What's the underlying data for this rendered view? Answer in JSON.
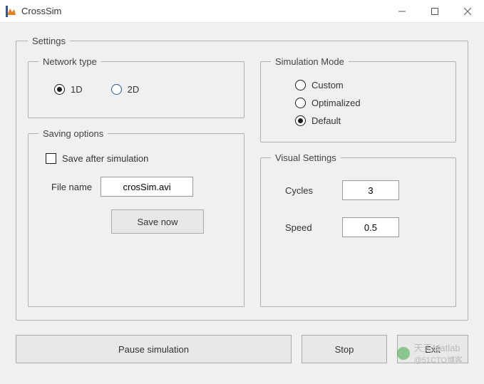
{
  "window": {
    "title": "CrossSim"
  },
  "settings": {
    "legend": "Settings",
    "networkType": {
      "legend": "Network type",
      "options": {
        "one": "1D",
        "two": "2D"
      },
      "selected": "1D"
    },
    "savingOptions": {
      "legend": "Saving options",
      "saveAfterLabel": "Save after simulation",
      "saveAfterChecked": false,
      "fileNameLabel": "File name",
      "fileNameValue": "crosSim.avi",
      "saveNowLabel": "Save now"
    },
    "simulationMode": {
      "legend": "Simulation Mode",
      "options": {
        "custom": "Custom",
        "optimalized": "Optimalized",
        "default": "Default"
      },
      "selected": "Default"
    },
    "visualSettings": {
      "legend": "Visual Settings",
      "cyclesLabel": "Cycles",
      "cyclesValue": "3",
      "speedLabel": "Speed",
      "speedValue": "0.5"
    }
  },
  "buttons": {
    "pause": "Pause simulation",
    "stop": "Stop",
    "exit": "Exit"
  },
  "watermark": {
    "text": "天天Matlab",
    "sub": "@51CTO博客"
  }
}
